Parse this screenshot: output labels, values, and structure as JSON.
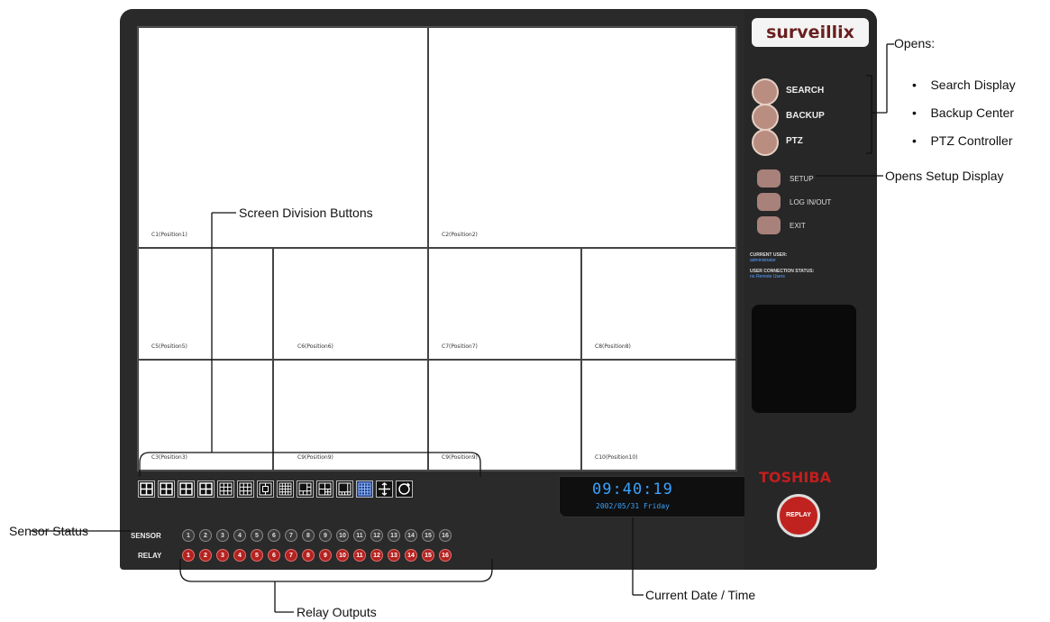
{
  "brand": {
    "logo": "surveillix",
    "maker": "TOSHIBA"
  },
  "cameras": [
    "C1(Position1)",
    "C2(Position2)",
    "C5(Position5)",
    "C6(Position6)",
    "C7(Position7)",
    "C8(Position8)",
    "C3(Position3)",
    "C9(Position9)",
    "C9(Position9)",
    "C10(Position10)"
  ],
  "clock": {
    "time": "09:40:19",
    "date": "2002/05/31 Friday"
  },
  "sensors": {
    "label": "SENSOR",
    "numbers": [
      "1",
      "2",
      "3",
      "4",
      "5",
      "6",
      "7",
      "8",
      "9",
      "10",
      "11",
      "12",
      "13",
      "14",
      "15",
      "16"
    ]
  },
  "relays": {
    "label": "RELAY",
    "numbers": [
      "1",
      "2",
      "3",
      "4",
      "5",
      "6",
      "7",
      "8",
      "9",
      "10",
      "11",
      "12",
      "13",
      "14",
      "15",
      "16"
    ]
  },
  "menu": {
    "search": "SEARCH",
    "backup": "BACKUP",
    "ptz": "PTZ",
    "setup": "SETUP",
    "login": "LOG IN/OUT",
    "exit": "EXIT"
  },
  "status": {
    "current_user_label": "CURRENT USER:",
    "current_user": "administrator",
    "connection_label": "USER CONNECTION STATUS:",
    "connection_value": "no Remote Users"
  },
  "replay_label": "REPLAY",
  "annotations": {
    "opens": "Opens:",
    "opens_items": [
      "Search Display",
      "Backup Center",
      "PTZ Controller"
    ],
    "setup": "Opens Setup Display",
    "screen_div": "Screen Division Buttons",
    "sensor_status": "Sensor Status",
    "relay_outputs": "Relay Outputs",
    "date_time": "Current Date / Time"
  },
  "colors": {
    "accent_blue": "#3aa2ff",
    "relay_red": "#b4221f",
    "body": "#2a2a2a"
  }
}
